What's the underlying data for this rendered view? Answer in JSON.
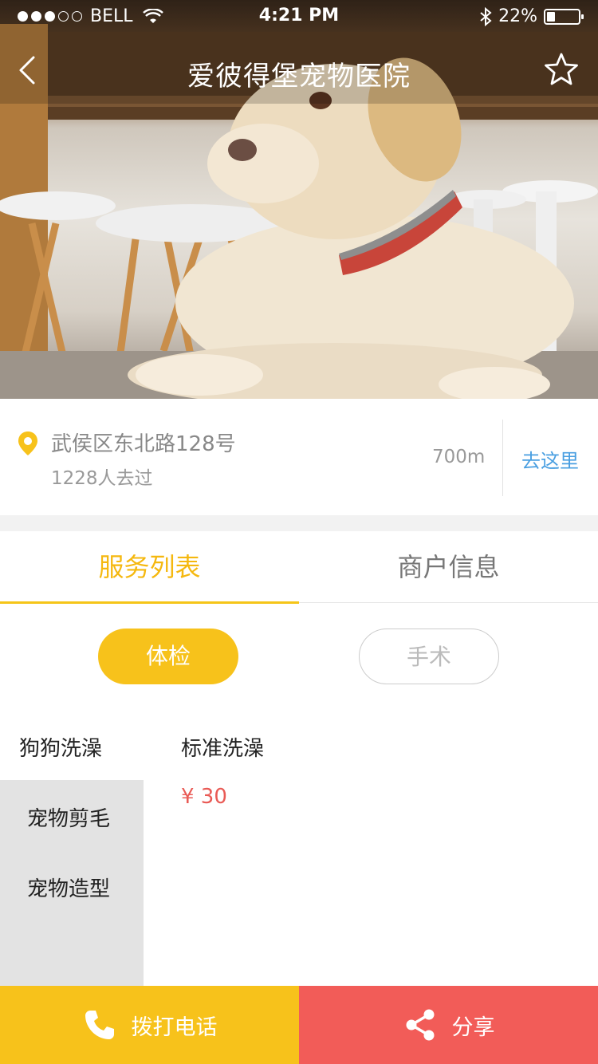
{
  "status_bar": {
    "carrier": "BELL",
    "time": "4:21 PM",
    "battery": "22%"
  },
  "header": {
    "title": "爱彼得堡宠物医院",
    "back_icon": "chevron-left-icon",
    "favorite_icon": "star-outline-icon"
  },
  "address": {
    "line": "武侯区东北路128号",
    "visitors": "1228人去过",
    "distance": "700m",
    "go_label": "去这里",
    "pin_icon": "location-pin-icon"
  },
  "tabs": [
    {
      "label": "服务列表",
      "active": true
    },
    {
      "label": "商户信息",
      "active": false
    }
  ],
  "filters": [
    {
      "label": "体检",
      "active": true
    },
    {
      "label": "手术",
      "active": false
    }
  ],
  "categories": [
    {
      "label": "狗狗洗澡",
      "selected": true
    },
    {
      "label": "宠物剪毛",
      "selected": false
    },
    {
      "label": "宠物造型",
      "selected": false
    }
  ],
  "service": {
    "name": "标准洗澡",
    "price": "¥ 30"
  },
  "actions": {
    "call_label": "拨打电话",
    "call_icon": "phone-icon",
    "share_label": "分享",
    "share_icon": "share-icon"
  },
  "colors": {
    "accent_yellow": "#f7c21b",
    "share_red": "#f25c58",
    "price_red": "#e95a55",
    "link_blue": "#4a9fe1"
  }
}
